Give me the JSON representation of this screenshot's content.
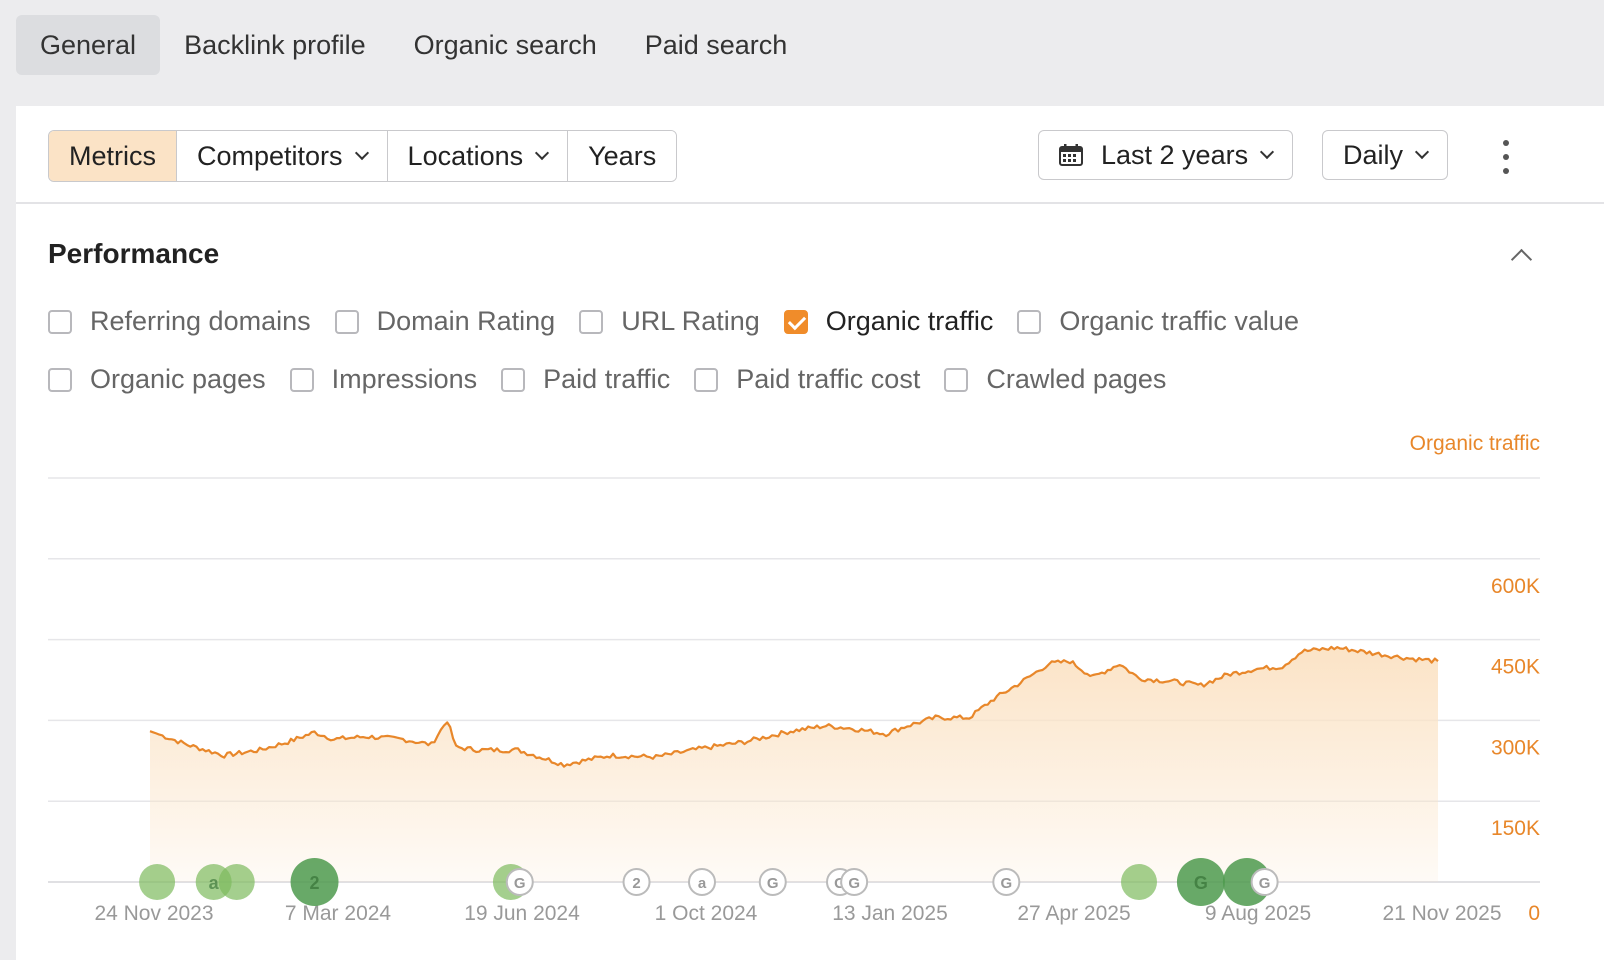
{
  "top_tabs": [
    {
      "label": "General",
      "active": true
    },
    {
      "label": "Backlink profile",
      "active": false
    },
    {
      "label": "Organic search",
      "active": false
    },
    {
      "label": "Paid search",
      "active": false
    }
  ],
  "toolbar": {
    "metrics": "Metrics",
    "competitors": "Competitors",
    "locations": "Locations",
    "years": "Years",
    "date_range": "Last 2 years",
    "interval": "Daily"
  },
  "performance": {
    "title": "Performance",
    "checkboxes_row1": [
      {
        "label": "Referring domains",
        "checked": false
      },
      {
        "label": "Domain Rating",
        "checked": false
      },
      {
        "label": "URL Rating",
        "checked": false
      },
      {
        "label": "Organic traffic",
        "checked": true
      },
      {
        "label": "Organic traffic value",
        "checked": false
      }
    ],
    "checkboxes_row2": [
      {
        "label": "Organic pages",
        "checked": false
      },
      {
        "label": "Impressions",
        "checked": false
      },
      {
        "label": "Paid traffic",
        "checked": false
      },
      {
        "label": "Paid traffic cost",
        "checked": false
      },
      {
        "label": "Crawled pages",
        "checked": false
      }
    ]
  },
  "colors": {
    "accent": "#e8872a",
    "fill": "#fbe3c6",
    "event_green": "#5aa84a"
  },
  "chart_data": {
    "type": "area",
    "series": [
      {
        "name": "Organic traffic",
        "color": "#e8872a"
      }
    ],
    "x_tick_labels": [
      "24 Nov 2023",
      "7 Mar 2024",
      "19 Jun 2024",
      "1 Oct 2024",
      "13 Jan 2025",
      "27 Apr 2025",
      "9 Aug 2025",
      "21 Nov 2025"
    ],
    "y_tick_labels": [
      "0",
      "150K",
      "300K",
      "450K",
      "600K"
    ],
    "ylim": [
      0,
      750000
    ],
    "points": [
      {
        "x": "2023-11-24",
        "y": 280000
      },
      {
        "x": "2023-12-15",
        "y": 255000
      },
      {
        "x": "2024-01-05",
        "y": 235000
      },
      {
        "x": "2024-01-25",
        "y": 245000
      },
      {
        "x": "2024-02-10",
        "y": 260000
      },
      {
        "x": "2024-02-25",
        "y": 278000
      },
      {
        "x": "2024-03-07",
        "y": 265000
      },
      {
        "x": "2024-03-25",
        "y": 270000
      },
      {
        "x": "2024-04-15",
        "y": 265000
      },
      {
        "x": "2024-05-01",
        "y": 255000
      },
      {
        "x": "2024-05-10",
        "y": 300000
      },
      {
        "x": "2024-05-15",
        "y": 250000
      },
      {
        "x": "2024-05-28",
        "y": 245000
      },
      {
        "x": "2024-06-19",
        "y": 245000
      },
      {
        "x": "2024-07-15",
        "y": 218000
      },
      {
        "x": "2024-08-10",
        "y": 235000
      },
      {
        "x": "2024-09-05",
        "y": 232000
      },
      {
        "x": "2024-10-01",
        "y": 248000
      },
      {
        "x": "2024-10-25",
        "y": 260000
      },
      {
        "x": "2024-11-20",
        "y": 280000
      },
      {
        "x": "2024-12-10",
        "y": 290000
      },
      {
        "x": "2024-12-25",
        "y": 285000
      },
      {
        "x": "2025-01-13",
        "y": 275000
      },
      {
        "x": "2025-01-25",
        "y": 290000
      },
      {
        "x": "2025-02-10",
        "y": 305000
      },
      {
        "x": "2025-03-01",
        "y": 305000
      },
      {
        "x": "2025-03-15",
        "y": 340000
      },
      {
        "x": "2025-03-30",
        "y": 370000
      },
      {
        "x": "2025-04-15",
        "y": 405000
      },
      {
        "x": "2025-04-27",
        "y": 410000
      },
      {
        "x": "2025-05-10",
        "y": 380000
      },
      {
        "x": "2025-05-25",
        "y": 405000
      },
      {
        "x": "2025-06-05",
        "y": 378000
      },
      {
        "x": "2025-06-25",
        "y": 372000
      },
      {
        "x": "2025-07-10",
        "y": 365000
      },
      {
        "x": "2025-07-25",
        "y": 385000
      },
      {
        "x": "2025-08-09",
        "y": 395000
      },
      {
        "x": "2025-08-25",
        "y": 400000
      },
      {
        "x": "2025-09-05",
        "y": 428000
      },
      {
        "x": "2025-09-25",
        "y": 435000
      },
      {
        "x": "2025-10-15",
        "y": 425000
      },
      {
        "x": "2025-11-05",
        "y": 415000
      },
      {
        "x": "2025-11-21",
        "y": 410000
      }
    ],
    "annotation_markers": [
      {
        "x": "2023-11-28",
        "label": "",
        "dark": false
      },
      {
        "x": "2023-12-30",
        "label": "a",
        "dark": false
      },
      {
        "x": "2024-01-12",
        "label": "",
        "dark": false
      },
      {
        "x": "2024-02-25",
        "label": "2",
        "dark": true
      },
      {
        "x": "2024-06-15",
        "label": "",
        "dark": false
      },
      {
        "x": "2024-06-20",
        "label": "G",
        "dark": false,
        "outline": true
      },
      {
        "x": "2024-08-25",
        "label": "2",
        "outline": true
      },
      {
        "x": "2024-10-01",
        "label": "a",
        "outline": true
      },
      {
        "x": "2024-11-10",
        "label": "G",
        "outline": true
      },
      {
        "x": "2024-12-18",
        "label": "G",
        "outline": true
      },
      {
        "x": "2024-12-26",
        "label": "G",
        "outline": true
      },
      {
        "x": "2025-03-22",
        "label": "G",
        "outline": true
      },
      {
        "x": "2025-06-05",
        "label": "",
        "dark": false
      },
      {
        "x": "2025-07-10",
        "label": "G",
        "dark": true
      },
      {
        "x": "2025-08-05",
        "label": "",
        "dark": true
      },
      {
        "x": "2025-08-15",
        "label": "G",
        "outline": true
      }
    ]
  }
}
